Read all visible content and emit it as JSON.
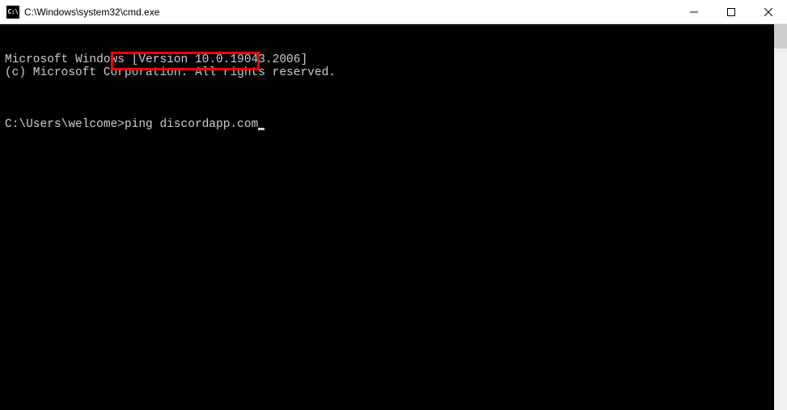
{
  "titlebar": {
    "icon_text": "C:\\",
    "title": "C:\\Windows\\system32\\cmd.exe"
  },
  "terminal": {
    "line1": "Microsoft Windows [Version 10.0.19043.2006]",
    "line2": "(c) Microsoft Corporation. All rights reserved.",
    "prompt": "C:\\Users\\welcome>",
    "command": "ping discordapp.com"
  }
}
